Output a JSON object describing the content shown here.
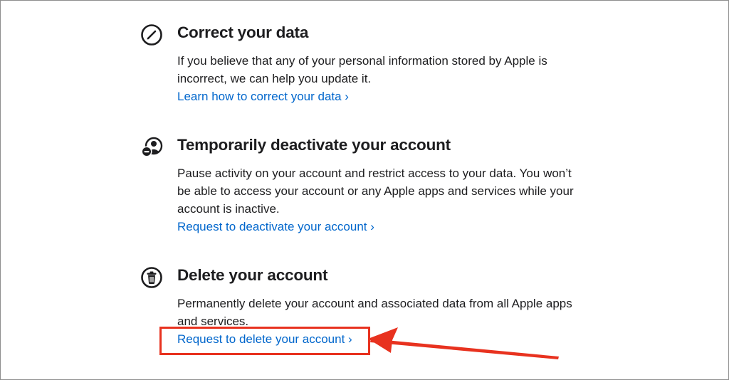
{
  "sections": [
    {
      "icon": "pencil-circle-icon",
      "title": "Correct your data",
      "description": "If you believe that any of your personal information stored by Apple is incorrect, we can help you update it.",
      "link": "Learn how to correct your data ›"
    },
    {
      "icon": "person-deactivate-icon",
      "title": "Temporarily deactivate your account",
      "description": "Pause activity on your account and restrict access to your data. You won’t be able to access your account or any Apple apps and services while your account is inactive.",
      "link": "Request to deactivate your account ›"
    },
    {
      "icon": "trash-circle-icon",
      "title": "Delete your account",
      "description": "Permanently delete your account and associated data from all Apple apps and services.",
      "link": "Request to delete your account ›"
    }
  ],
  "annotation": {
    "color": "#e8321f",
    "arrow_icon": "red-arrow-icon"
  },
  "colors": {
    "link": "#0066cc",
    "text": "#1d1d1f"
  }
}
